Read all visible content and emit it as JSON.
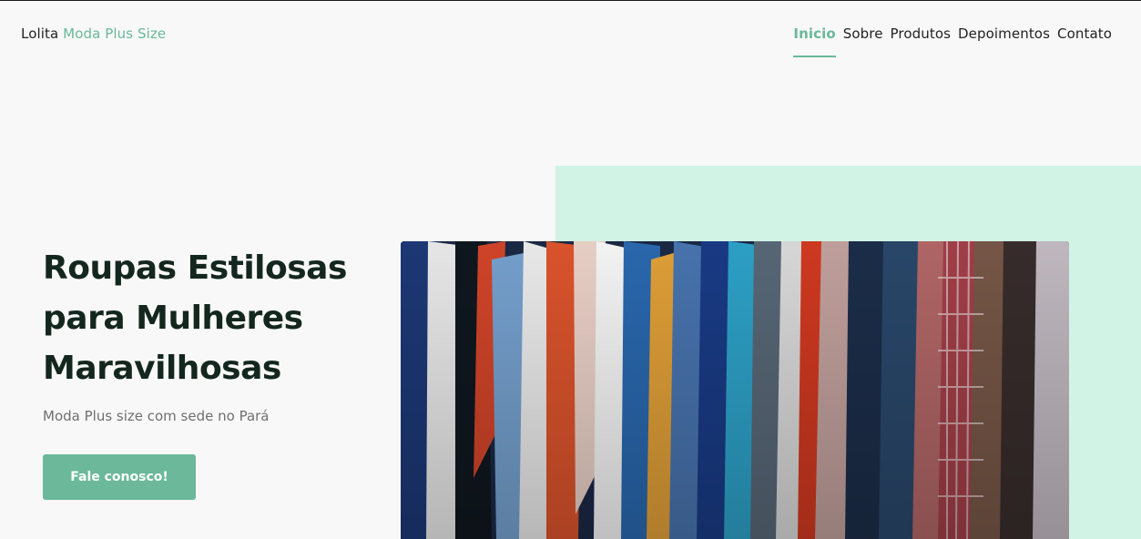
{
  "header": {
    "logo_main": "Lolita",
    "logo_accent": "Moda Plus Size",
    "nav": [
      {
        "label": "Inicio",
        "active": true
      },
      {
        "label": "Sobre",
        "active": false
      },
      {
        "label": "Produtos",
        "active": false
      },
      {
        "label": "Depoimentos",
        "active": false
      },
      {
        "label": "Contato",
        "active": false
      }
    ]
  },
  "hero": {
    "title": "Roupas Estilosas para Mulheres Maravilhosas",
    "subtitle": "Moda Plus size com sede no Pará",
    "cta_label": "Fale conosco!",
    "image_alt": "photo-of-clothes-hanging-on-rack"
  },
  "colors": {
    "accent": "#6bb89b",
    "mint": "#d0f3e5",
    "title": "#14271f",
    "background": "#f8f8f8"
  }
}
